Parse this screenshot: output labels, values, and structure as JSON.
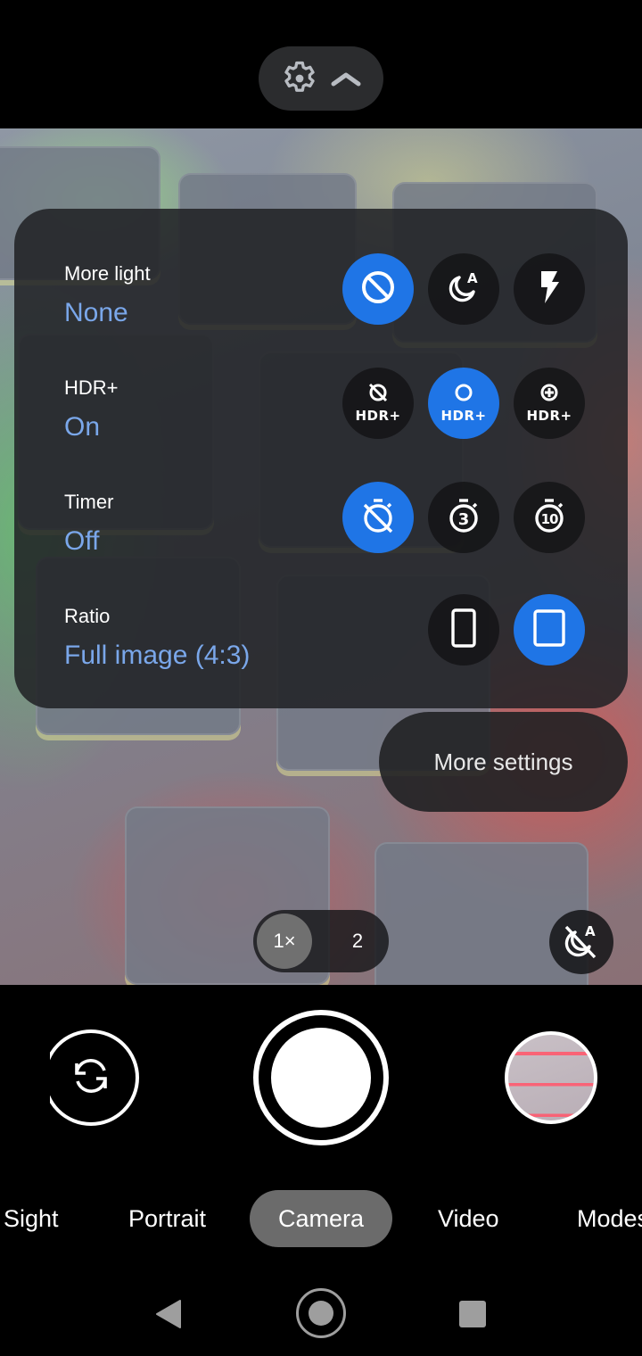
{
  "top_bar": {
    "settings_icon": "gear-icon",
    "collapse_icon": "chevron-up-icon"
  },
  "settings_panel": {
    "rows": [
      {
        "label": "More light",
        "value": "None",
        "options": [
          {
            "icon": "none-circle-slash-icon",
            "selected": true
          },
          {
            "icon": "night-sight-auto-icon",
            "selected": false
          },
          {
            "icon": "flash-icon",
            "selected": false
          }
        ]
      },
      {
        "label": "HDR+",
        "value": "On",
        "options": [
          {
            "icon": "hdr-off-icon",
            "text": "HDR+",
            "selected": false
          },
          {
            "icon": "hdr-on-icon",
            "text": "HDR+",
            "selected": true
          },
          {
            "icon": "hdr-enhanced-icon",
            "text": "HDR+",
            "selected": false
          }
        ]
      },
      {
        "label": "Timer",
        "value": "Off",
        "options": [
          {
            "icon": "timer-off-icon",
            "selected": true
          },
          {
            "icon": "timer-3-icon",
            "text": "3",
            "selected": false
          },
          {
            "icon": "timer-10-icon",
            "text": "10",
            "selected": false
          }
        ]
      },
      {
        "label": "Ratio",
        "value": "Full image (4:3)",
        "options": [
          {
            "icon": "ratio-tall-icon",
            "selected": false
          },
          {
            "icon": "ratio-4-3-icon",
            "selected": true
          }
        ]
      }
    ]
  },
  "more_settings": {
    "label": "More settings"
  },
  "zoom": {
    "active": "1×",
    "other": "2"
  },
  "night_sight_toggle": {
    "icon": "night-sight-auto-off-icon",
    "badge": "A"
  },
  "modes": {
    "items": [
      "Sight",
      "Portrait",
      "Camera",
      "Video",
      "Modes"
    ],
    "active": "Camera"
  },
  "colors": {
    "accent": "#1f75e6",
    "value_text": "#7aa7ea",
    "panel_bg": "#202124"
  }
}
